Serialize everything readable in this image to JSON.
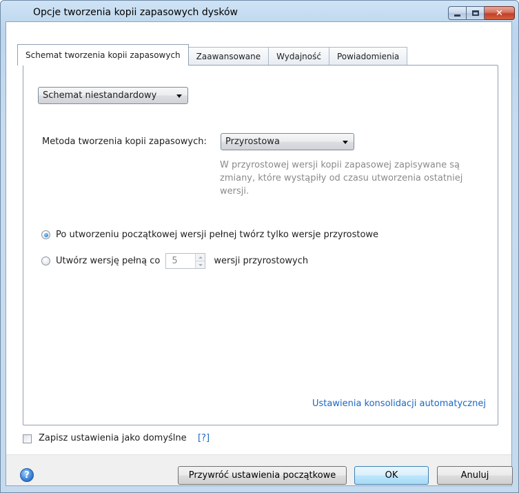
{
  "window": {
    "title": "Opcje tworzenia kopii zapasowych dysków"
  },
  "tabs": [
    {
      "label": "Schemat tworzenia kopii zapasowych",
      "active": true
    },
    {
      "label": "Zaawansowane",
      "active": false
    },
    {
      "label": "Wydajność",
      "active": false
    },
    {
      "label": "Powiadomienia",
      "active": false
    }
  ],
  "scheme": {
    "selected": "Schemat niestandardowy"
  },
  "method": {
    "label": "Metoda tworzenia kopii zapasowych:",
    "selected": "Przyrostowa",
    "hint": "W przyrostowej wersji kopii zapasowej zapisywane są zmiany, które wystąpiły od czasu utworzenia ostatniej wersji."
  },
  "options": {
    "incremental_only": {
      "label": "Po utworzeniu początkowej wersji pełnej twórz tylko wersje przyrostowe",
      "checked": true
    },
    "full_every": {
      "label_before": "Utwórz wersję pełną co",
      "value": "5",
      "label_after": "wersji przyrostowych",
      "checked": false
    }
  },
  "links": {
    "auto_consolidation": "Ustawienia konsolidacji automatycznej",
    "help": "[?]"
  },
  "save_default": {
    "label": "Zapisz ustawienia jako domyślne",
    "checked": false
  },
  "buttons": {
    "restore": "Przywróć ustawienia początkowe",
    "ok": "OK",
    "cancel": "Anuluj",
    "help_icon": "?"
  },
  "icons": {
    "minimize": "minimize-icon",
    "maximize": "maximize-icon",
    "close": "close-icon",
    "help": "help-icon"
  },
  "colors": {
    "link": "#1a66c4",
    "hint": "#8a8a8a",
    "close_button": "#c0402a"
  }
}
